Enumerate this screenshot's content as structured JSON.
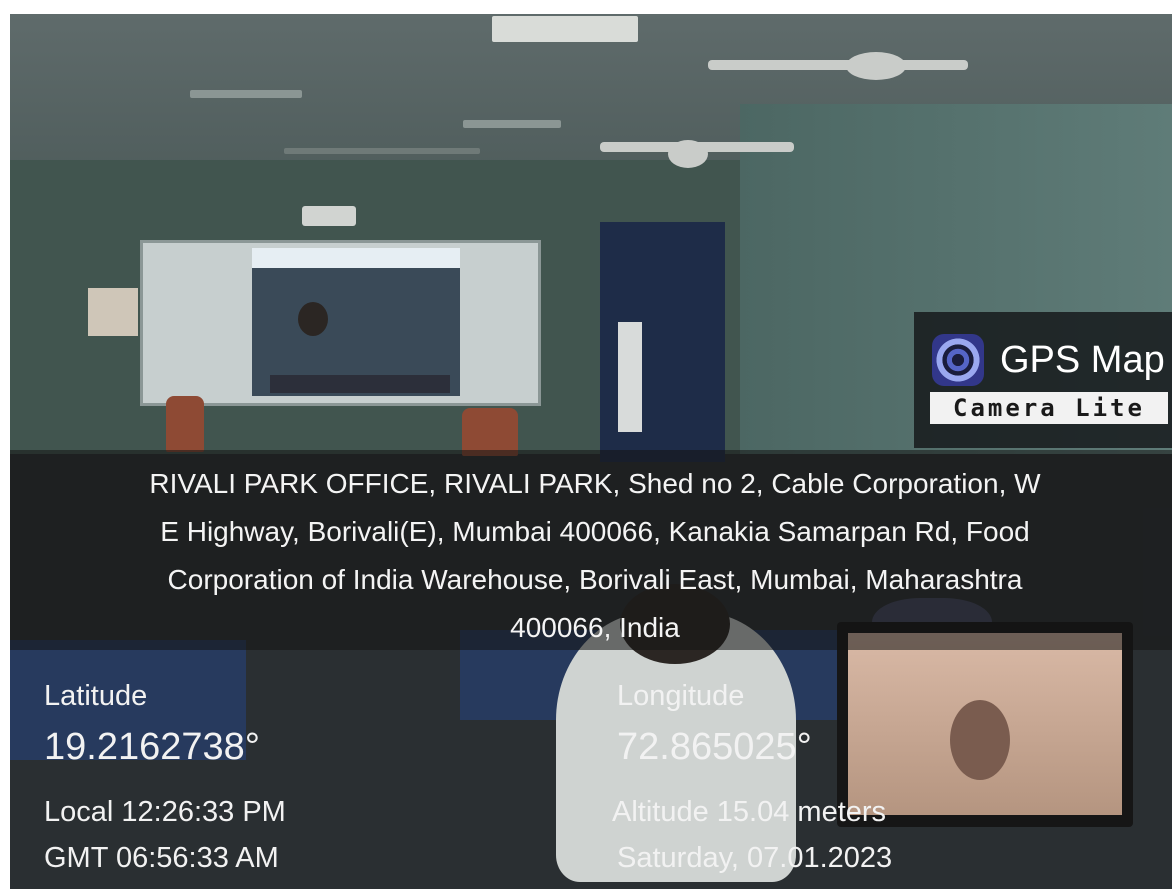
{
  "brand": {
    "title": "GPS Map",
    "subtitle": "Camera Lite",
    "icon": "camera-lens-icon"
  },
  "address": [
    "RIVALI PARK OFFICE, RIVALI PARK, Shed no 2, Cable Corporation, W",
    "E Highway, Borivali(E), Mumbai 400066, Kanakia Samarpan Rd, Food",
    "Corporation of India Warehouse, Borivali East, Mumbai, Maharashtra",
    "400066, India"
  ],
  "location": {
    "latitude_label": "Latitude",
    "latitude_value": "19.2162738°",
    "longitude_label": "Longitude",
    "longitude_value": "72.865025°"
  },
  "time": {
    "local": "Local 12:26:33 PM",
    "gmt": "GMT 06:56:33 AM",
    "altitude": "Altitude 15.04 meters",
    "date": "Saturday, 07.01.2023"
  }
}
